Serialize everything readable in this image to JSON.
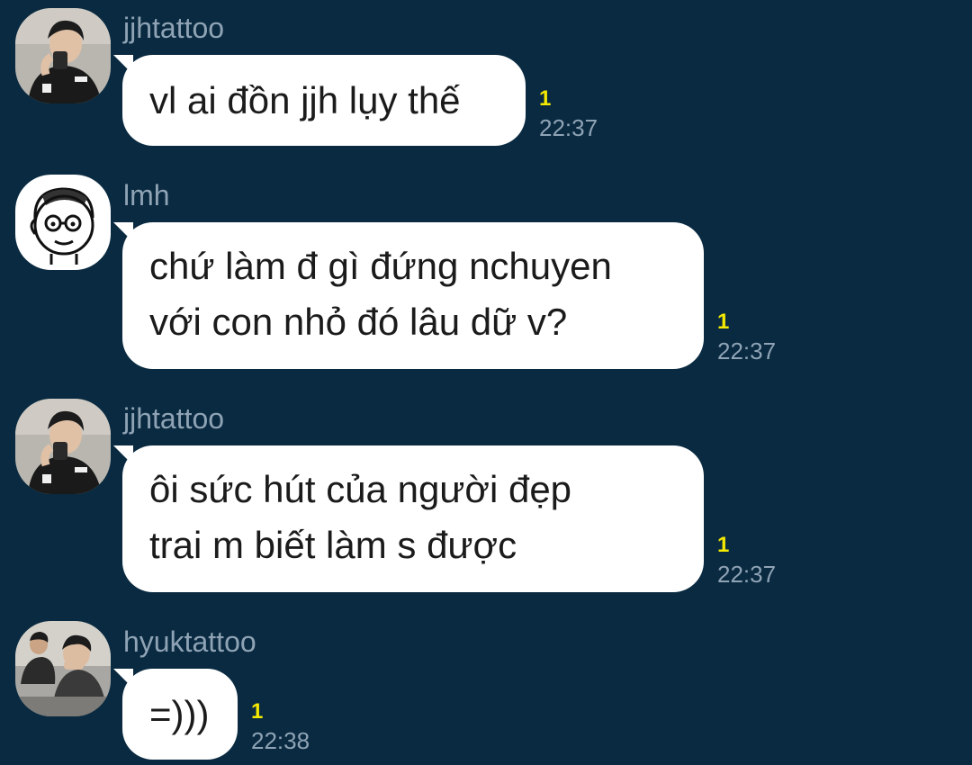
{
  "messages": [
    {
      "sender": "jjhtattoo",
      "avatar": "photo-avatar-jjhtattoo",
      "lines": [
        "vl ai đồn jjh lụy thế"
      ],
      "unread": "1",
      "time": "22:37"
    },
    {
      "sender": "lmh",
      "avatar": "cartoon-avatar-lmh",
      "lines": [
        "chứ làm đ gì đứng nchuyen",
        "với con nhỏ đó lâu dữ v?"
      ],
      "unread": "1",
      "time": "22:37"
    },
    {
      "sender": "jjhtattoo",
      "avatar": "photo-avatar-jjhtattoo",
      "lines": [
        "ôi sức hút của người đẹp",
        "trai m biết làm s được"
      ],
      "unread": "1",
      "time": "22:37"
    },
    {
      "sender": "hyuktattoo",
      "avatar": "photo-avatar-hyuktattoo",
      "lines": [
        "=)))"
      ],
      "unread": "1",
      "time": "22:38"
    }
  ],
  "colors": {
    "background": "#092a40",
    "bubble": "#ffffff",
    "sender_text": "#8fa3b5",
    "unread_badge": "#f4e900"
  }
}
